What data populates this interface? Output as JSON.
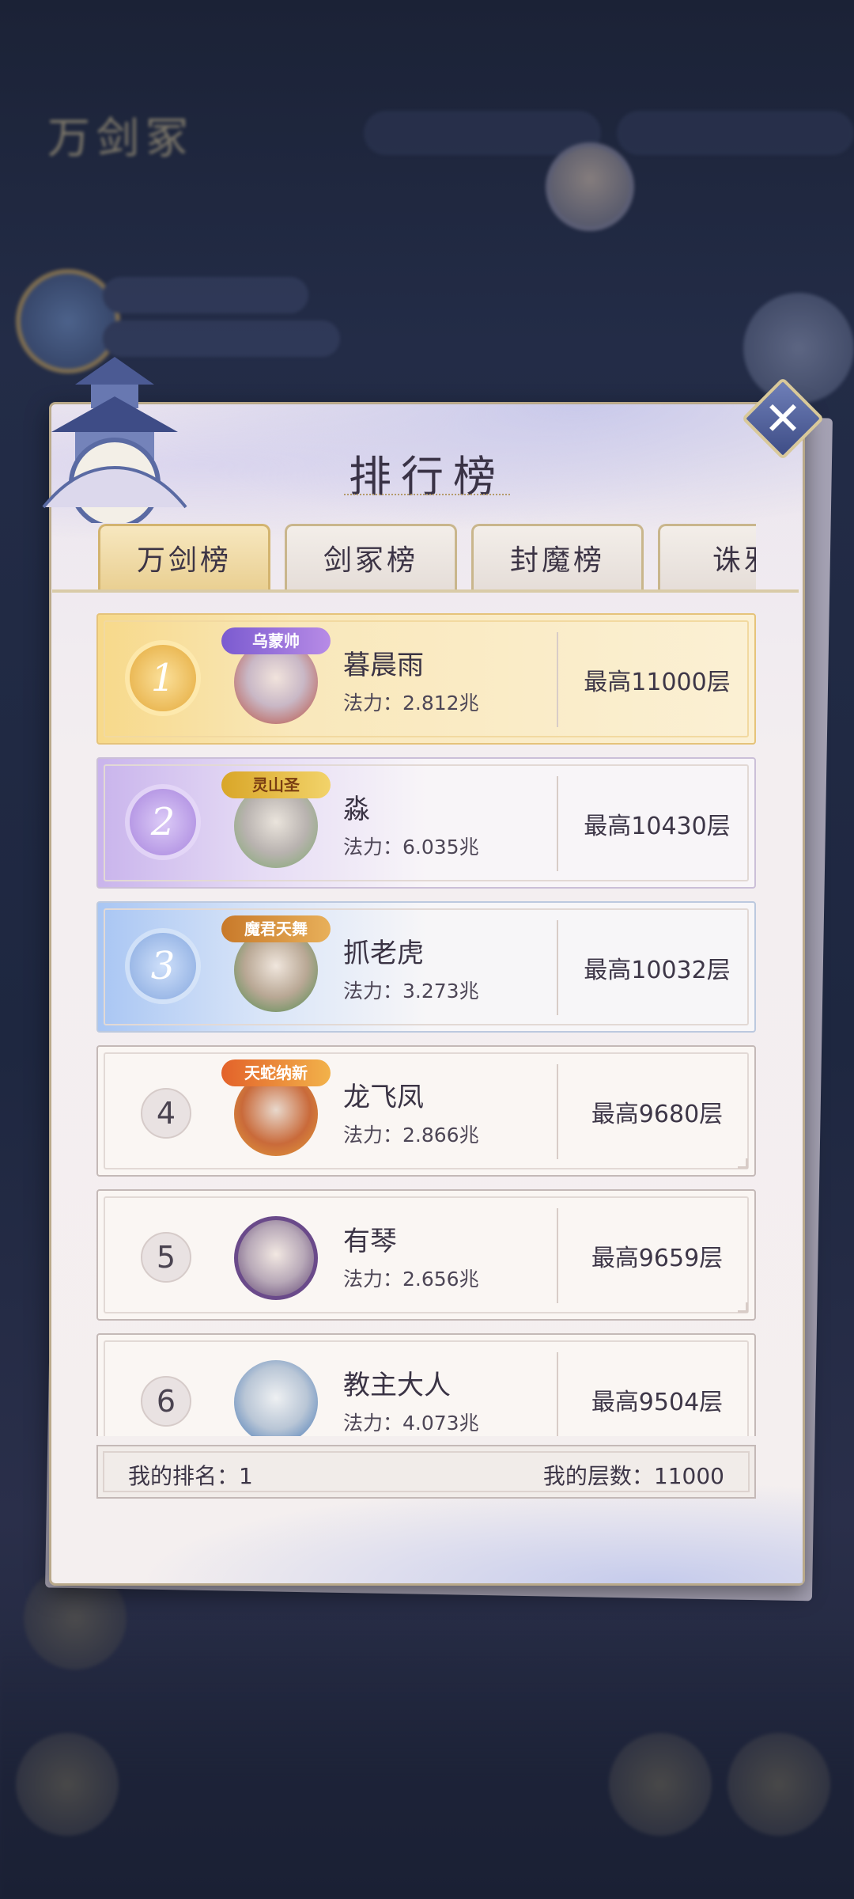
{
  "background": {
    "title": "万剑冢"
  },
  "panel": {
    "title": "排行榜",
    "close_label": "✕"
  },
  "tabs": [
    {
      "label": "万剑榜",
      "active": true
    },
    {
      "label": "剑冢榜",
      "active": false
    },
    {
      "label": "封魔榜",
      "active": false
    },
    {
      "label": "诛邪",
      "active": false
    }
  ],
  "rankings": [
    {
      "rank": "1",
      "name": "暮晨雨",
      "power": "法力：2.812兆",
      "best": "最高11000层",
      "frame_title": "乌蒙帅",
      "style": "gold"
    },
    {
      "rank": "2",
      "name": "淼",
      "power": "法力：6.035兆",
      "best": "最高10430层",
      "frame_title": "灵山圣",
      "style": "silver"
    },
    {
      "rank": "3",
      "name": "抓老虎",
      "power": "法力：3.273兆",
      "best": "最高10032层",
      "frame_title": "魔君天舞",
      "style": "bronze"
    },
    {
      "rank": "4",
      "name": "龙飞凤",
      "power": "法力：2.866兆",
      "best": "最高9680层",
      "frame_title": "天蛇纳新",
      "style": "plain"
    },
    {
      "rank": "5",
      "name": "有琴",
      "power": "法力：2.656兆",
      "best": "最高9659层",
      "frame_title": "",
      "style": "plain"
    },
    {
      "rank": "6",
      "name": "教主大人",
      "power": "法力：4.073兆",
      "best": "最高9504层",
      "frame_title": "",
      "style": "plain"
    }
  ],
  "my_info": {
    "rank_label": "我的排名：1",
    "floor_label": "我的层数：11000"
  },
  "colors": {
    "gold": "#e4a93a",
    "silver": "#a885de",
    "bronze": "#86a8df",
    "frame": "#c9b68c"
  }
}
